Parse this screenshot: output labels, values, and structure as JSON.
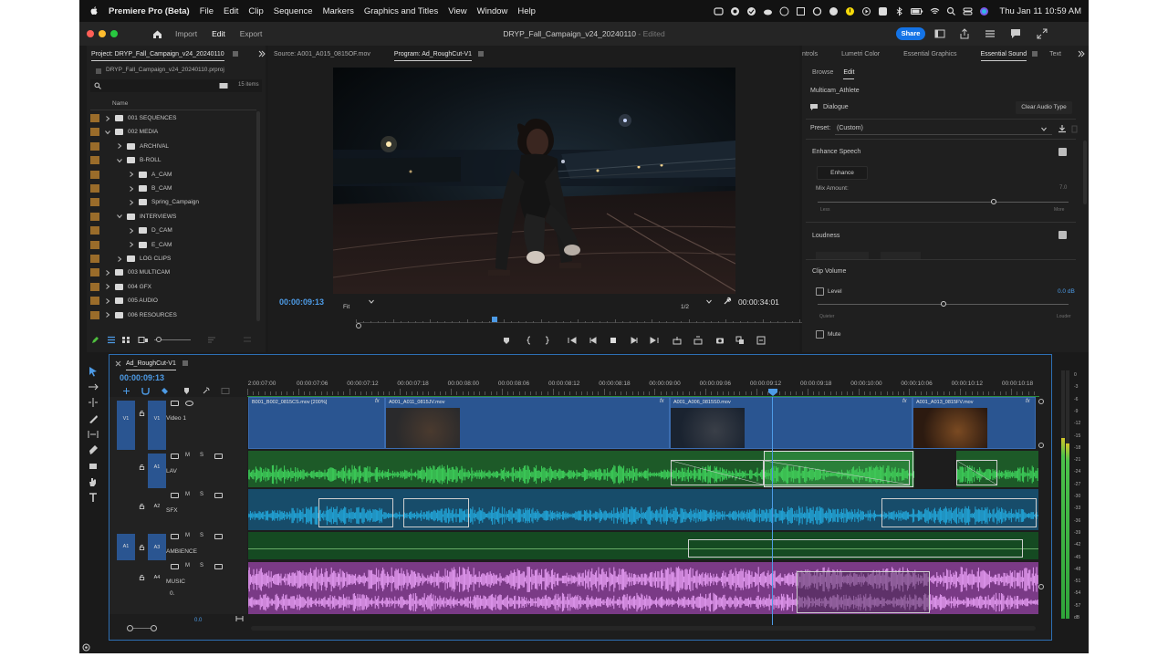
{
  "menubar": {
    "app_name": "Premiere Pro (Beta)",
    "items": [
      "File",
      "Edit",
      "Clip",
      "Sequence",
      "Markers",
      "Graphics and Titles",
      "View",
      "Window",
      "Help"
    ],
    "datetime": "Thu Jan 11  10:59 AM"
  },
  "header": {
    "workspaces": [
      "Import",
      "Edit",
      "Export"
    ],
    "active_workspace": "Edit",
    "document_title": "DRYP_Fall_Campaign_v24_20240110",
    "edited": " - Edited",
    "share_label": "Share"
  },
  "project": {
    "tab": "Project: DRYP_Fall_Campaign_v24_20240110",
    "file": "DRYP_Fall_Campaign_v24_20240110.prproj",
    "item_count": "15 items",
    "column_name": "Name",
    "rows": [
      {
        "label": "001 SEQUENCES",
        "depth": 0,
        "open": false
      },
      {
        "label": "002 MEDIA",
        "depth": 0,
        "open": true
      },
      {
        "label": "ARCHIVAL",
        "depth": 1,
        "open": false
      },
      {
        "label": "B-ROLL",
        "depth": 1,
        "open": true
      },
      {
        "label": "A_CAM",
        "depth": 2,
        "open": false
      },
      {
        "label": "B_CAM",
        "depth": 2,
        "open": false
      },
      {
        "label": "Spring_Campaign",
        "depth": 2,
        "open": false
      },
      {
        "label": "INTERVIEWS",
        "depth": 1,
        "open": true
      },
      {
        "label": "D_CAM",
        "depth": 2,
        "open": false
      },
      {
        "label": "E_CAM",
        "depth": 2,
        "open": false
      },
      {
        "label": "LOG CLIPS",
        "depth": 1,
        "open": false
      },
      {
        "label": "003 MULTICAM",
        "depth": 0,
        "open": false
      },
      {
        "label": "004 GFX",
        "depth": 0,
        "open": false
      },
      {
        "label": "005 AUDIO",
        "depth": 0,
        "open": false
      },
      {
        "label": "006 RESOURCES",
        "depth": 0,
        "open": false
      }
    ]
  },
  "program": {
    "source_tab": "Source: A001_A015_0815OF.mov",
    "program_tab": "Program: Ad_RoughCut-V1",
    "timecode": "00:00:09:13",
    "fit": "Fit",
    "resolution": "1/2",
    "duration": "00:00:34:01",
    "playhead_fraction": 0.27
  },
  "esound": {
    "tabs": [
      "ntrols",
      "Lumetri Color",
      "Essential Graphics",
      "Essential Sound",
      "Text"
    ],
    "active_tab": "Essential Sound",
    "subtabs": [
      "Browse",
      "Edit"
    ],
    "active_subtab": "Edit",
    "clip_name": "Multicam_Athlete",
    "audio_type": "Dialogue",
    "clear_label": "Clear Audio Type",
    "preset_label": "Preset:",
    "preset_value": "(Custom)",
    "enhance_speech": "Enhance Speech",
    "enhance_button": "Enhance",
    "mix_amount_label": "Mix Amount:",
    "mix_amount_value": "7.0",
    "mix_less": "Less",
    "mix_more": "More",
    "mix_fraction": 0.7,
    "loudness": "Loudness",
    "clip_volume": "Clip Volume",
    "level_label": "Level",
    "level_value": "0.0 dB",
    "quieter": "Quieter",
    "louder": "Louder",
    "level_fraction": 0.5,
    "mute_label": "Mute"
  },
  "timeline": {
    "sequence_tab": "Ad_RoughCut-V1",
    "timecode": "00:00:09:13",
    "ruler": [
      "00:00:07:00",
      "00:00:07:06",
      "00:00:07:12",
      "00:00:07:18",
      "00:00:08:00",
      "00:00:08:06",
      "00:00:08:12",
      "00:00:08:18",
      "00:00:09:00",
      "00:00:09:06",
      "00:00:09:12",
      "00:00:09:18",
      "00:00:10:00",
      "00:00:10:06",
      "00:00:10:12",
      "00:00:10:18"
    ],
    "ruler_first_display": "2:00:07:00",
    "tracks": {
      "v1": {
        "src": "V1",
        "target": "V1",
        "name": "Video 1"
      },
      "a1": {
        "target": "A1",
        "name": "LAV"
      },
      "a2": {
        "target": "A2",
        "name": "SFX"
      },
      "a3": {
        "src": "A1",
        "target": "A3",
        "name": "AMBIENCE"
      },
      "a4": {
        "target": "A4",
        "name": "MUSIC",
        "vol": "0.",
        "footer_value": "0.0"
      }
    },
    "video_clips": [
      {
        "name": "B001_B002_0815CS.mov [200%]"
      },
      {
        "name": "A001_A011_0815JV.mov"
      },
      {
        "name": "A001_A006_0815S0.mov"
      },
      {
        "name": "A001_A013_0815FV.mov"
      }
    ],
    "track_buttons": {
      "mute": "M",
      "solo": "S"
    }
  },
  "meter": {
    "scale": [
      "0",
      "-3",
      "-6",
      "-9",
      "-12",
      "-15",
      "-18",
      "-21",
      "-24",
      "-27",
      "-30",
      "-33",
      "-36",
      "-39",
      "-42",
      "-45",
      "-48",
      "-51",
      "-54",
      "-57",
      "dB"
    ]
  },
  "colors": {
    "accent": "#1473e6",
    "video_clip": "#2a5591",
    "lav_audio": "#2fae48",
    "sfx_audio": "#1d8fbf",
    "music_audio": "#d98be4",
    "folder_label": "#9a6c2a",
    "playhead": "#4d9be6"
  }
}
